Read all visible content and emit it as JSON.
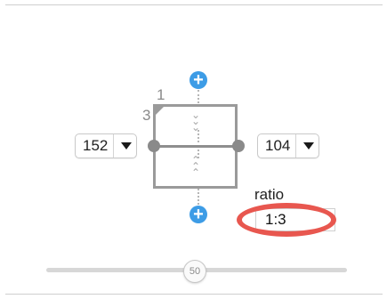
{
  "split": {
    "top_number": "1",
    "side_number": "3"
  },
  "left_stepper": {
    "value": "152"
  },
  "right_stepper": {
    "value": "104"
  },
  "ratio": {
    "label": "ratio",
    "value": "1:3"
  },
  "slider": {
    "value": "50"
  },
  "colors": {
    "accent": "#3d9ce6",
    "highlight": "#e8574f",
    "frame": "#9a9a9a"
  },
  "icons": [
    "plus-circle-icon",
    "chevron-double-down-icon",
    "chevron-double-up-icon",
    "dropdown-arrow-icon"
  ]
}
